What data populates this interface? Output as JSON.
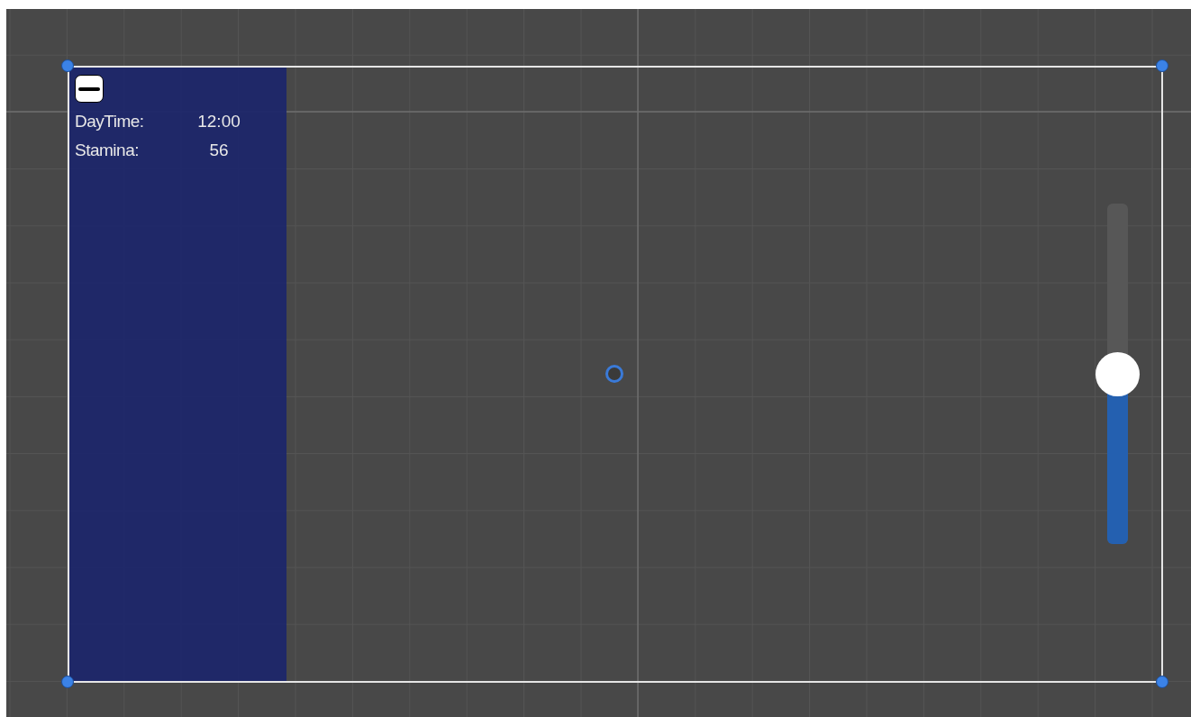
{
  "panel": {
    "minimize_button": true,
    "stats": [
      {
        "label": "DayTime:",
        "value": "12:00"
      },
      {
        "label": "Stamina:",
        "value": "56"
      }
    ]
  },
  "slider": {
    "level": 0.5
  }
}
